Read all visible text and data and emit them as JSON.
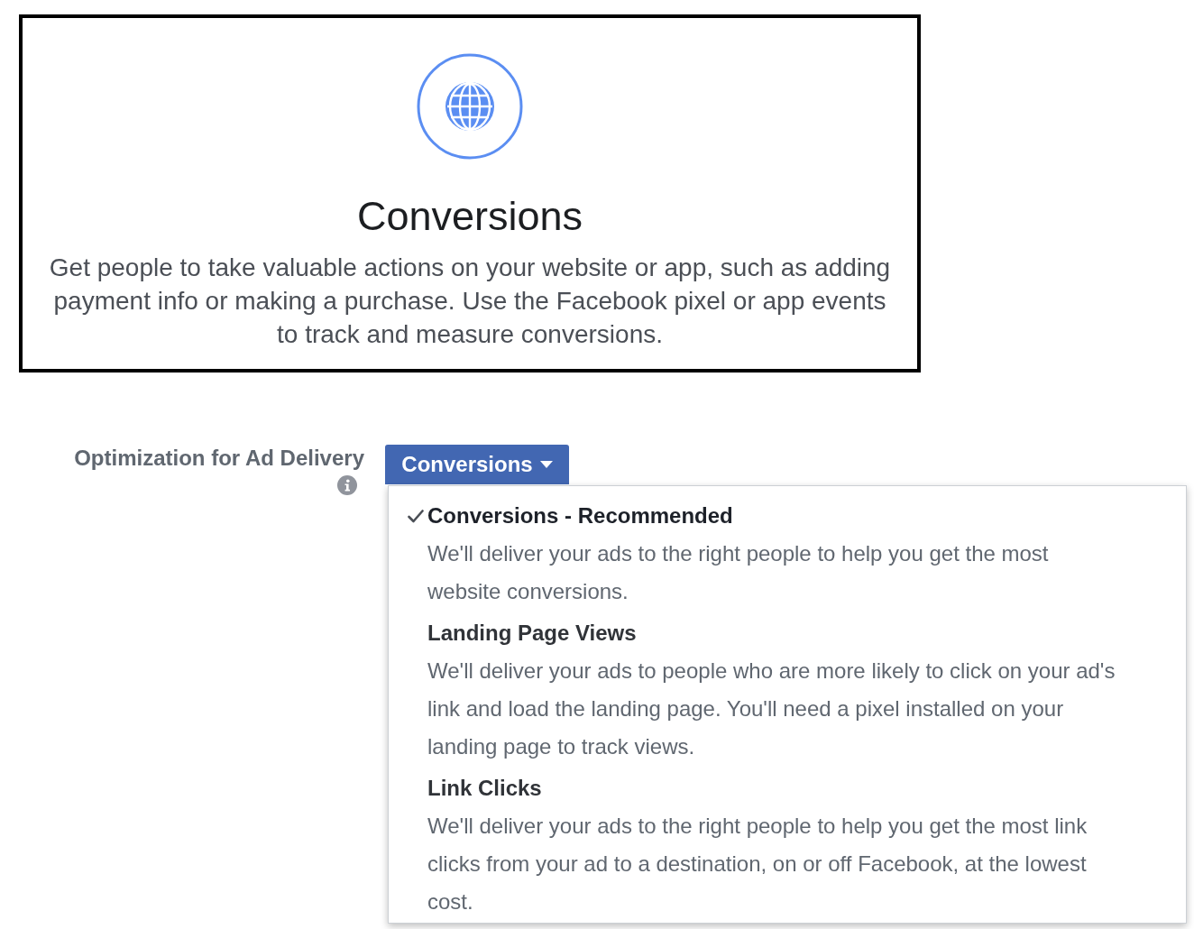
{
  "objective_card": {
    "title": "Conversions",
    "description": "Get people to take valuable actions on your website or app, such as adding payment info or making a purchase. Use the Facebook pixel or app events to track and measure conversions."
  },
  "optimization": {
    "label": "Optimization for Ad Delivery",
    "button": {
      "label": "Conversions"
    },
    "menu": {
      "items": [
        {
          "title": "Conversions - Recommended",
          "description": "We'll deliver your ads to the right people to help you get the most website conversions.",
          "selected": true
        },
        {
          "title": "Landing Page Views",
          "description": "We'll deliver your ads to people who are more likely to click on your ad's link and load the landing page. You'll need a pixel installed on your landing page to track views.",
          "selected": false
        },
        {
          "title": "Link Clicks",
          "description": "We'll deliver your ads to the right people to help you get the most link clicks from your ad to a destination, on or off Facebook, at the lowest cost.",
          "selected": false
        }
      ]
    }
  }
}
